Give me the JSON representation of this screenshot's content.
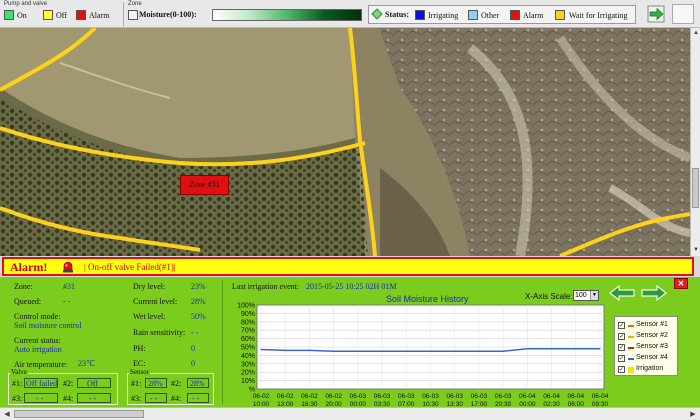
{
  "legend": {
    "pump_valve_caption": "Pump and valve",
    "on_label": "On",
    "off_label": "Off",
    "alarm_label": "Alarm",
    "on_color": "#3ee06a",
    "off_color": "#ffff30",
    "alarm_color": "#e01010",
    "zone_caption": "Zone",
    "moisture_label": "Moisture(0-100):",
    "status_label": "Status:",
    "statuses": [
      {
        "label": "Irrigating",
        "color": "#0a10d8"
      },
      {
        "label": "Other",
        "color": "#8fd0ee"
      },
      {
        "label": "Alarm",
        "color": "#e01010"
      },
      {
        "label": "Wait for Irrigating",
        "color": "#ffd21a"
      }
    ]
  },
  "map": {
    "zone_tag": "Zone #31"
  },
  "alarm": {
    "title": "Alarm!",
    "message": "| On-off valve Failed(#1)|"
  },
  "zone_info": {
    "zone_label": "Zone:",
    "zone_value": "#31",
    "queued_label": "Queued:",
    "queued_value": "- -",
    "control_mode_label": "Control mode:",
    "control_mode_value": "Soil moisture control",
    "current_status_label": "Current status:",
    "current_status_value": "Auto irrigation",
    "air_temp_label": "Air temperature:",
    "air_temp_value": "23℃",
    "dry_level_label": "Dry level:",
    "dry_level_value": "23%",
    "current_level_label": "Current level:",
    "current_level_value": "28%",
    "wet_level_label": "Wet level:",
    "wet_level_value": "50%",
    "rain_label": "Rain sensitivity:",
    "rain_value": "- -",
    "ph_label": "PH:",
    "ph_value": "0",
    "ec_label": "EC:",
    "ec_value": "0"
  },
  "valve": {
    "caption": "Valve",
    "items": [
      {
        "label": "#1:",
        "value": "Off failed"
      },
      {
        "label": "#2:",
        "value": "Off"
      },
      {
        "label": "#3:",
        "value": "- -"
      },
      {
        "label": "#4:",
        "value": "- -"
      }
    ]
  },
  "sensor": {
    "caption": "Sensor",
    "items": [
      {
        "label": "#1:",
        "value": "28%"
      },
      {
        "label": "#2:",
        "value": "28%"
      },
      {
        "label": "#3:",
        "value": "- -"
      },
      {
        "label": "#4:",
        "value": "- -"
      }
    ]
  },
  "last_event": {
    "label": "Last irrigation event:",
    "value": "2015-05-25 10:25   02H 01M"
  },
  "chart_controls": {
    "xscale_label": "X-Axis Scale:",
    "xscale_value": "100"
  },
  "chart_data": {
    "type": "line",
    "title": "Soil Moisture History",
    "ylim": [
      0,
      100
    ],
    "yticks": [
      "100%",
      "90%",
      "80%",
      "70%",
      "60%",
      "50%",
      "40%",
      "30%",
      "20%",
      "10%",
      "%"
    ],
    "xticks": [
      [
        "06-02",
        "10:00"
      ],
      [
        "06-02",
        "13:00"
      ],
      [
        "06-02",
        "16:30"
      ],
      [
        "06-02",
        "20:00"
      ],
      [
        "06-03",
        "00:00"
      ],
      [
        "06-03",
        "03:30"
      ],
      [
        "06-03",
        "07:00"
      ],
      [
        "06-03",
        "10:30"
      ],
      [
        "06-03",
        "13:30"
      ],
      [
        "06-03",
        "17:00"
      ],
      [
        "06-03",
        "20:30"
      ],
      [
        "06-04",
        "00:00"
      ],
      [
        "06-04",
        "02:30"
      ],
      [
        "06-04",
        "06:00"
      ],
      [
        "06-04",
        "09:30"
      ]
    ],
    "series": [
      {
        "name": "Sensor #4",
        "color": "#3a66c4",
        "x": [
          0,
          1,
          2,
          3,
          4,
          5,
          6,
          7,
          8,
          9,
          10,
          11,
          12,
          13,
          14
        ],
        "values": [
          47,
          46,
          46,
          45,
          45,
          45,
          45,
          45,
          45,
          45,
          45,
          48,
          48,
          48,
          48
        ]
      }
    ],
    "legend": [
      {
        "name": "Sensor #1",
        "color": "#e07010",
        "checked": true
      },
      {
        "name": "Sensor #2",
        "color": "#e8b000",
        "checked": true
      },
      {
        "name": "Sensor #3",
        "color": "#d02020",
        "checked": true
      },
      {
        "name": "Sensor #4",
        "color": "#3a66c4",
        "checked": true
      },
      {
        "name": "Irrigation",
        "color": "#f0e020",
        "checked": true
      }
    ]
  }
}
